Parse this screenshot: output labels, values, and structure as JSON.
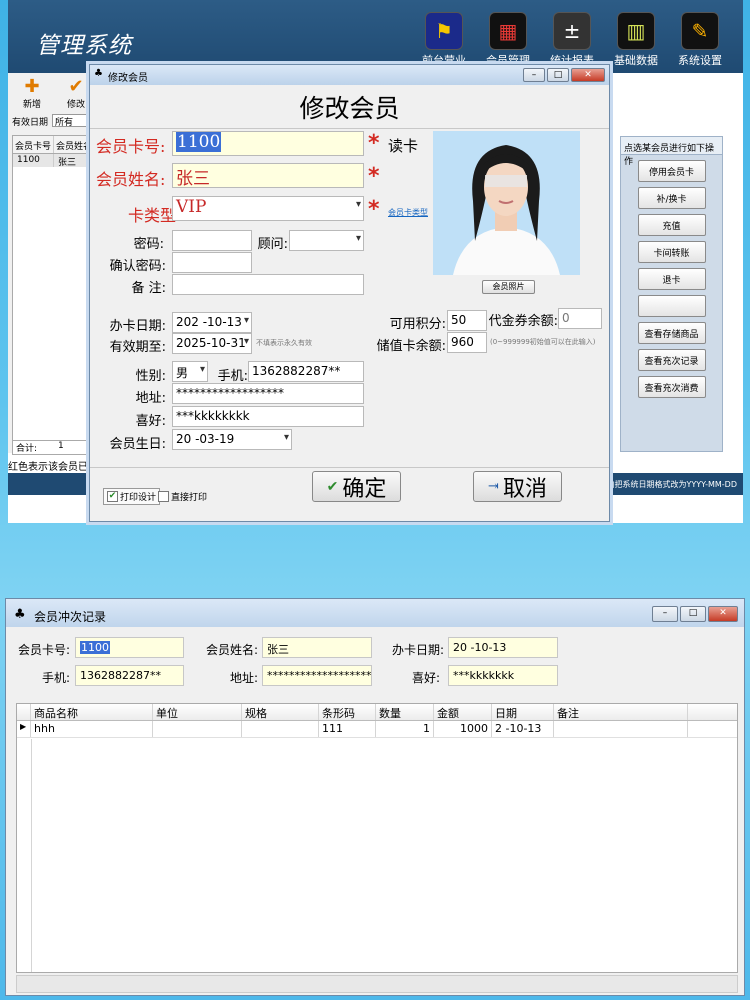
{
  "main": {
    "title": "管理系统",
    "nav": [
      {
        "label": "前台营业",
        "icon": "pos-terminal-icon",
        "glyph": "⚑"
      },
      {
        "label": "会员管理",
        "icon": "members-grid-icon",
        "glyph": "▦"
      },
      {
        "label": "统计报表",
        "icon": "calculator-icon",
        "glyph": "±"
      },
      {
        "label": "基础数据",
        "icon": "barcode-icon",
        "glyph": "▥"
      },
      {
        "label": "系统设置",
        "icon": "settings-tools-icon",
        "glyph": "✎"
      }
    ],
    "toolbar": {
      "add": "新增",
      "edit": "修改"
    },
    "filter": {
      "label": "有效日期",
      "value": "所有"
    },
    "grid": {
      "headers": [
        "会员卡号",
        "会员姓名"
      ],
      "row": [
        "1100",
        "张三"
      ],
      "total_label": "合计:",
      "total_value": "1"
    },
    "red_tip": "红色表示该会员已",
    "right_panel": {
      "header": "点选某会员进行如下操作",
      "buttons": [
        "停用会员卡",
        "补/换卡",
        "充值",
        "卡间转账",
        "退卡",
        "",
        "查看存储商品",
        "查看充次记录",
        "查看充次消费"
      ]
    },
    "bottom_hint": "内把系统日期格式改为YYYY-MM-DD"
  },
  "dialog": {
    "window_title": "修改会员",
    "heading": "修改会员",
    "card_no_label": "会员卡号:",
    "card_no": "1100",
    "read_card": "读卡",
    "name_label": "会员姓名:",
    "name": "张三",
    "type_label": "卡类型:",
    "type": "VIP",
    "type_link": "会员卡类型",
    "password_label": "密码:",
    "advisor_label": "顾问:",
    "confirm_label": "确认密码:",
    "remark_label": "备 注:",
    "photo_button": "会员照片",
    "open_date_label": "办卡日期:",
    "open_date": "202  -10-13",
    "expiry_label": "有效期至:",
    "expiry": "2025-10-31",
    "expiry_tip": "不填表示永久有效",
    "points_label": "可用积分:",
    "points": "50",
    "voucher_label": "代金券余额:",
    "voucher": "0",
    "stored_label": "储值卡余额:",
    "stored": "960",
    "stored_tip": "(0~999999初始值可以在此输入)",
    "gender_label": "性别:",
    "gender": "男",
    "phone_label": "手机:",
    "phone": "1362882287**",
    "address_label": "地址:",
    "address": "******************",
    "hobby_label": "喜好:",
    "hobby": "***kkkkkkkk",
    "birthday_label": "会员生日:",
    "birthday": "20   -03-19",
    "print_design": "打印设计",
    "direct_print": "直接打印",
    "ok": "确定",
    "cancel": "取消"
  },
  "recharge": {
    "window_title": "会员冲次记录",
    "card_label": "会员卡号:",
    "card": "1100",
    "name_label": "会员姓名:",
    "name": "张三",
    "date_label": "办卡日期:",
    "date": "20   -10-13",
    "phone_label": "手机:",
    "phone": "1362882287**",
    "address_label": "地址:",
    "address": "*******************",
    "hobby_label": "喜好:",
    "hobby": "***kkkkkkk",
    "columns": [
      "商品名称",
      "单位",
      "规格",
      "条形码",
      "数量",
      "金额",
      "日期",
      "备注"
    ],
    "rows": [
      [
        "hhh",
        "",
        "",
        "111",
        "1",
        "1000",
        "2    -10-13",
        ""
      ]
    ]
  }
}
